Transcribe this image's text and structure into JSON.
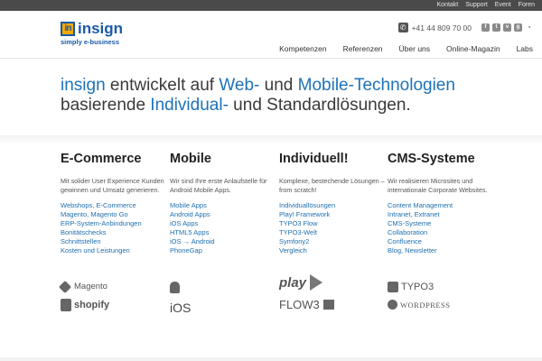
{
  "topbar": {
    "links": [
      "Kontakt",
      "Support",
      "Event",
      "Foren"
    ]
  },
  "logo": {
    "mark": "in",
    "word": "insign",
    "tagline": "simply e-business"
  },
  "contact": {
    "phone": "+41 44 809 70 00"
  },
  "social": {
    "icons": [
      "facebook-icon",
      "twitter-icon",
      "vimeo-icon",
      "google-plus-icon",
      "rss-icon"
    ]
  },
  "nav": [
    "Kompetenzen",
    "Referenzen",
    "Über uns",
    "Online-Magazin",
    "Labs"
  ],
  "intro": {
    "p1": "insign",
    "p2": " entwickelt auf ",
    "p3": "Web-",
    "p4": " und ",
    "p5": "Mobile-Technologien",
    "p6": "basierende ",
    "p7": "Individual-",
    "p8": " und Standardlösungen."
  },
  "columns": [
    {
      "title": "E-Commerce",
      "text": "Mit solider User Experience Kunden gewinnen und Umsatz generieren.",
      "links": [
        "Webshops, E-Commerce",
        "Magento, Magento Go",
        "ERP-System-Anbindungen",
        "Bonitätschecks",
        "Schnittstellen",
        "Kosten und Leistungen"
      ],
      "logos": [
        "Magento",
        "shopify"
      ]
    },
    {
      "title": "Mobile",
      "text": "Wir sind Ihre erste Anlaufstelle für Android Mobile Apps.",
      "links": [
        "Mobile Apps",
        "Android Apps",
        "iOS Apps",
        "HTML5 Apps",
        "iOS → Android",
        "PhoneGap"
      ],
      "logos": [
        "",
        "iOS"
      ]
    },
    {
      "title": "Individuell!",
      "text": "Komplexe, bestechende Lösungen – from scratch!",
      "links": [
        "Individuallösungen",
        "Play! Framework",
        "TYPO3 Flow",
        "TYPO3-Welt",
        "Symfony2",
        "Vergleich"
      ],
      "logos": [
        "play",
        "FLOW3"
      ]
    },
    {
      "title": "CMS-Systeme",
      "text": "Wir realisieren Microsites und internationale Corporate Websites.",
      "links": [
        "Content Management",
        "Intranet, Extranet",
        "CMS-Systeme",
        "Collaboration",
        "Confluence",
        "Blog, Newsletter"
      ],
      "logos": [
        "TYPO3",
        "WordPress"
      ]
    }
  ]
}
